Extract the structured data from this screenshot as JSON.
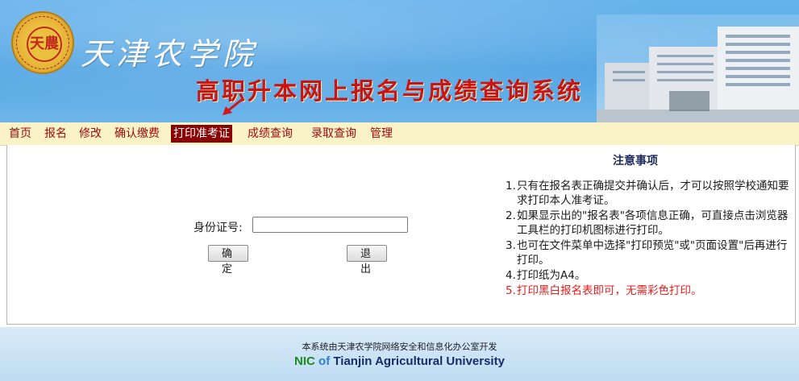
{
  "header": {
    "logo_text": "天農",
    "school_name": "天津农学院",
    "system_title": "高职升本网上报名与成绩查询系统"
  },
  "nav": {
    "items": [
      {
        "label": "首页"
      },
      {
        "label": "报名"
      },
      {
        "label": "修改"
      },
      {
        "label": "确认缴费"
      },
      {
        "label": "打印准考证",
        "active": true
      },
      {
        "label": "成绩查询"
      },
      {
        "label": "录取查询"
      },
      {
        "label": "管理"
      }
    ]
  },
  "form": {
    "id_label": "身份证号:",
    "id_value": "",
    "ok_label": "确 定",
    "exit_label": "退 出"
  },
  "notice": {
    "title": "注意事项",
    "items": [
      {
        "num": "1.",
        "text": "只有在报名表正确提交并确认后，才可以按照学校通知要求打印本人准考证。"
      },
      {
        "num": "2.",
        "text": "如果显示出的\"报名表\"各项信息正确，可直接点击浏览器工具栏的打印机图标进行打印。"
      },
      {
        "num": "3.",
        "text": "也可在文件菜单中选择\"打印预览\"或\"页面设置\"后再进行打印。"
      },
      {
        "num": "4.",
        "text": "打印纸为A4。"
      },
      {
        "num": "5.",
        "text": "打印黑白报名表即可，无需彩色打印。"
      }
    ]
  },
  "footer": {
    "developer": "本系统由天津农学院网络安全和信息化办公室开发",
    "nic": "NIC",
    "of": "of",
    "university": "Tianjin Agricultural University"
  },
  "colors": {
    "banner": "#4fa3e3",
    "nav_bg": "#fbf3c8",
    "nav_text": "#a30a0a",
    "nav_active_bg": "#8b0000",
    "title_red": "#c81414",
    "notice_red": "#e22020"
  }
}
